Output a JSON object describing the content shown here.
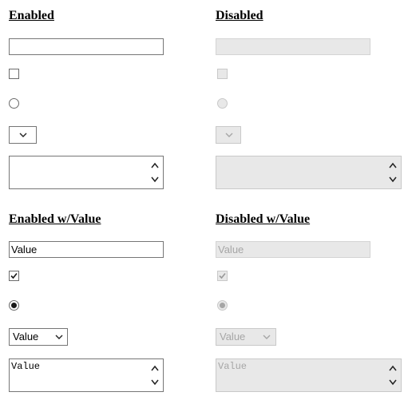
{
  "sections": {
    "enabled": {
      "heading": "Enabled"
    },
    "disabled": {
      "heading": "Disabled"
    },
    "enabled_value": {
      "heading": "Enabled w/Value",
      "text_value": "Value",
      "checkbox_checked": true,
      "radio_selected": true,
      "select_value": "Value",
      "textarea_value": "Value"
    },
    "disabled_value": {
      "heading": "Disabled w/Value",
      "text_value": "Value",
      "checkbox_checked": true,
      "radio_selected": true,
      "select_value": "Value",
      "textarea_value": "Value"
    }
  },
  "icons": {
    "checkmark": "checkmark-icon",
    "dropdown": "chevron-down-icon",
    "textarea_spinner": "chevron-up-down-icon"
  },
  "colors": {
    "enabled_border": "#767676",
    "disabled_fill": "#e8e8e8",
    "disabled_text": "#a6a6a6"
  }
}
